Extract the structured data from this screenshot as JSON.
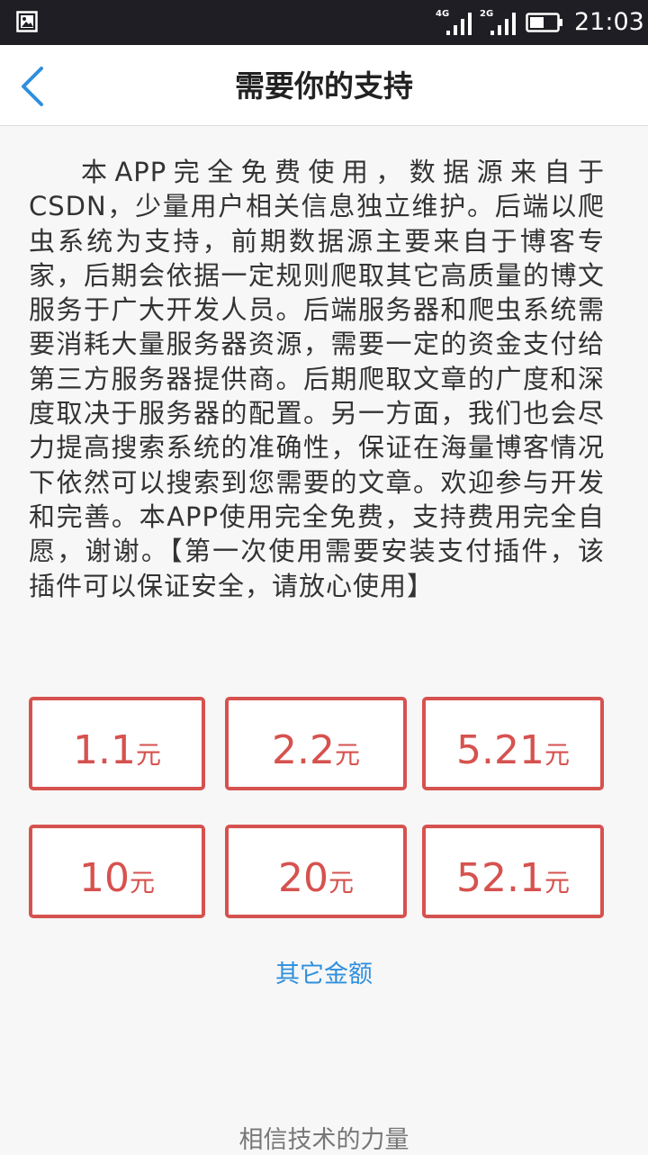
{
  "status_bar": {
    "time": "21:03",
    "sim1_network": "4G",
    "sim2_network": "2G",
    "left_icon": "image-icon",
    "battery_icon": "battery-icon"
  },
  "header": {
    "title": "需要你的支持",
    "back_icon": "chevron-left-icon"
  },
  "description": "本APP完全免费使用，数据源来自于CSDN，少量用户相关信息独立维护。后端以爬虫系统为支持，前期数据源主要来自于博客专家，后期会依据一定规则爬取其它高质量的博文服务于广大开发人员。后端服务器和爬虫系统需要消耗大量服务器资源，需要一定的资金支付给第三方服务器提供商。后期爬取文章的广度和深度取决于服务器的配置。另一方面，我们也会尽力提高搜索系统的准确性，保证在海量博客情况下依然可以搜索到您需要的文章。欢迎参与开发和完善。本APP使用完全免费，支持费用完全自愿，谢谢。【第一次使用需要安装支付插件，该插件可以保证安全，请放心使用】",
  "amounts": [
    {
      "value": "1.1",
      "unit": "元"
    },
    {
      "value": "2.2",
      "unit": "元"
    },
    {
      "value": "5.21",
      "unit": "元"
    },
    {
      "value": "10",
      "unit": "元"
    },
    {
      "value": "20",
      "unit": "元"
    },
    {
      "value": "52.1",
      "unit": "元"
    }
  ],
  "other_amount_label": "其它金额",
  "footer": "相信技术的力量",
  "colors": {
    "accent_red": "#d6524f",
    "link_blue": "#2f8fde",
    "status_bar_bg": "#1e1e24"
  }
}
